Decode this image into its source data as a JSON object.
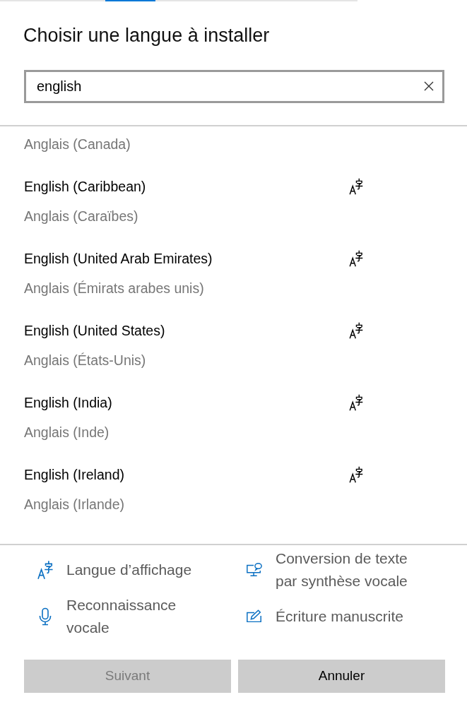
{
  "dialog": {
    "title": "Choisir une langue à installer"
  },
  "search": {
    "value": "english"
  },
  "languages": [
    {
      "localized_name": "Anglais (Canada)"
    },
    {
      "name": "English (Caribbean)",
      "localized_name": "Anglais (Caraïbes)",
      "features": [
        {
          "kind": "display_language"
        }
      ]
    },
    {
      "name": "English (United Arab Emirates)",
      "localized_name": "Anglais (Émirats arabes unis)",
      "features": [
        {
          "kind": "display_language"
        }
      ]
    },
    {
      "name": "English (United States)",
      "localized_name": "Anglais (États-Unis)",
      "features": [
        {
          "kind": "display_language"
        }
      ]
    },
    {
      "name": "English (India)",
      "localized_name": "Anglais (Inde)",
      "features": [
        {
          "kind": "display_language"
        }
      ]
    },
    {
      "name": "English (Ireland)",
      "localized_name": "Anglais (Irlande)",
      "features": [
        {
          "kind": "display_language"
        }
      ]
    }
  ],
  "legend": [
    {
      "kind": "display_language",
      "label": "Langue d’affichage"
    },
    {
      "kind": "text_to_speech",
      "label": "Conversion de texte par synthèse vocale"
    },
    {
      "kind": "speech",
      "label": "Reconnaissance vocale"
    },
    {
      "kind": "handwriting",
      "label": "Écriture manuscrite"
    }
  ],
  "buttons": [
    {
      "label": "Suivant",
      "disabled": true
    },
    {
      "label": "Annuler",
      "disabled": false
    }
  ]
}
